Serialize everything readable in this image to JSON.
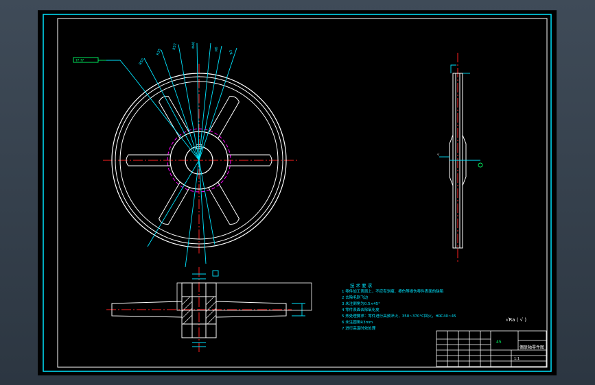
{
  "colors": {
    "frame": "#00e5ff",
    "outline": "#ffffff",
    "centerline": "#ff2020",
    "annotation": "#00e5ff",
    "pitch_circle": "#ff00ff",
    "note_text": "#00e5ff",
    "leader_box": "#00ff66",
    "title_block": "#00ff66"
  },
  "leader_label": "?? ??",
  "tech_notes": {
    "title": "技 术 要 求",
    "lines": [
      "1  零件加工表面上，不应有划痕、擦伤等损伤零件表面的缺陷",
      "2  去除毛刺飞边",
      "3  未注倒角为0.5×45°",
      "4  零件表面去除氧化皮",
      "5  热处理要求：零件进行高频淬火，350~370°C回火，HRC40~45",
      "6  未注圆角R3mm",
      "7  进行高温时效处理"
    ]
  },
  "surface_finish": "√Ra   ( √ )",
  "title_block": {
    "drawing_name": "偶联轴零件图",
    "material": "45",
    "scale": "1:1"
  }
}
